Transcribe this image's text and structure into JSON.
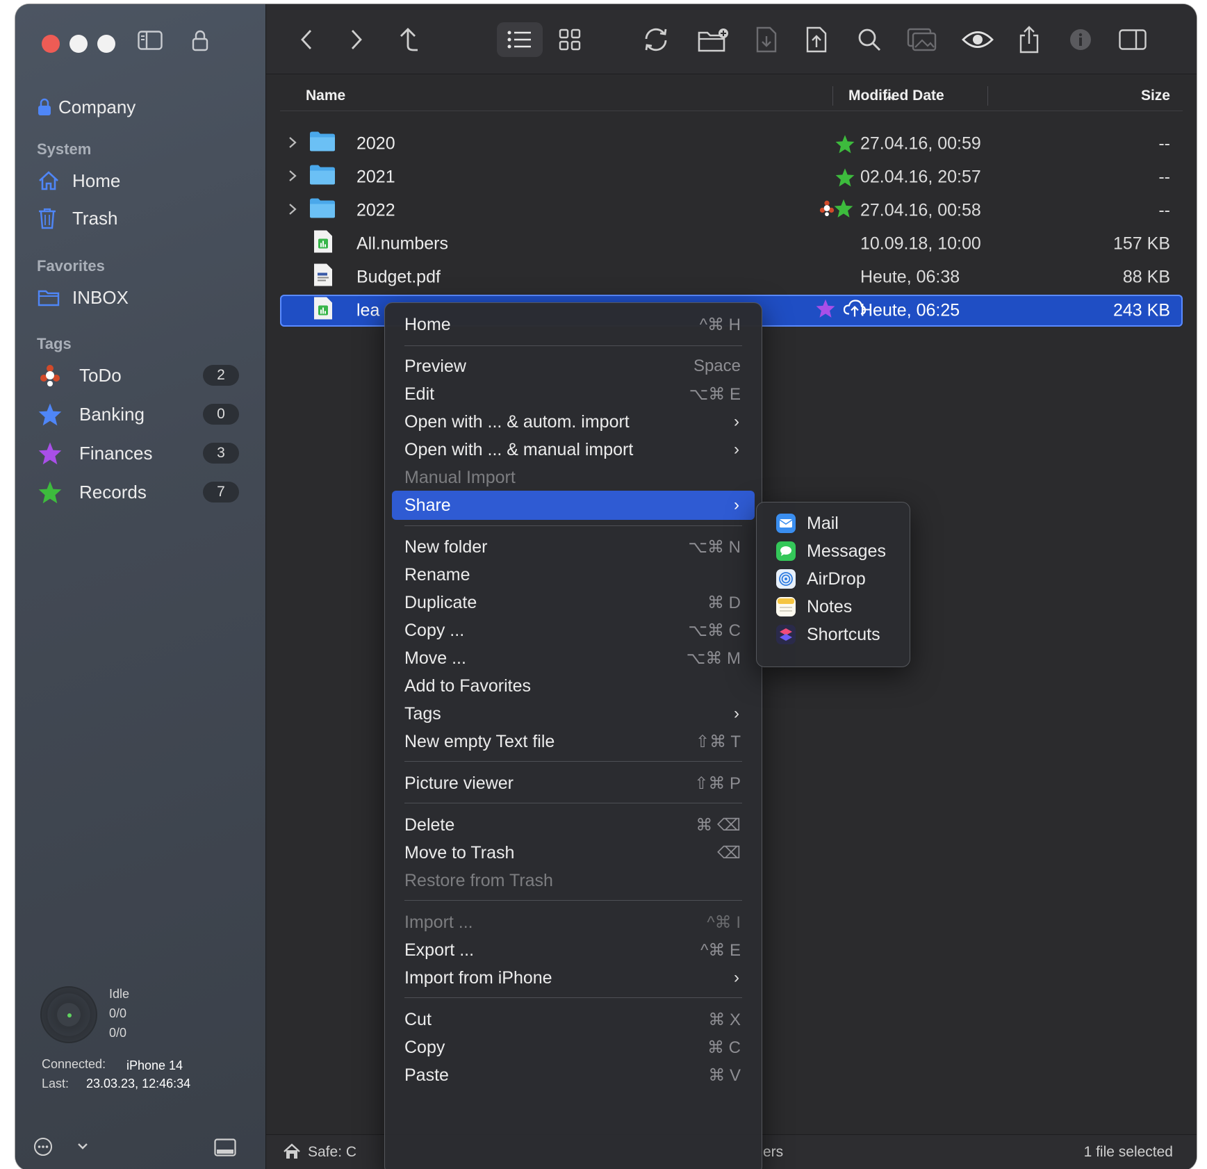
{
  "sidebar": {
    "vault": "Company",
    "system_label": "System",
    "home": "Home",
    "trash": "Trash",
    "favorites_label": "Favorites",
    "inbox": "INBOX",
    "tags_label": "Tags",
    "tags": [
      {
        "name": "ToDo",
        "count": "2"
      },
      {
        "name": "Banking",
        "count": "0"
      },
      {
        "name": "Finances",
        "count": "3"
      },
      {
        "name": "Records",
        "count": "7"
      }
    ],
    "status": {
      "state": "Idle",
      "line1": "0/0",
      "line2": "0/0"
    },
    "connected_label": "Connected:",
    "connected_value": "iPhone 14",
    "last_label": "Last:",
    "last_value": "23.03.23, 12:46:34"
  },
  "columns": {
    "name": "Name",
    "modified": "Modified Date",
    "size": "Size"
  },
  "rows": [
    {
      "name": "2020",
      "date": "27.04.16, 00:59",
      "size": "--"
    },
    {
      "name": "2021",
      "date": "02.04.16, 20:57",
      "size": "--"
    },
    {
      "name": "2022",
      "date": "27.04.16, 00:58",
      "size": "--"
    },
    {
      "name": "All.numbers",
      "date": "10.09.18, 10:00",
      "size": "157 KB"
    },
    {
      "name": "Budget.pdf",
      "date": "Heute, 06:38",
      "size": "88 KB"
    },
    {
      "name": "lea",
      "date": "Heute, 06:25",
      "size": "243 KB"
    }
  ],
  "menu": {
    "home": {
      "label": "Home",
      "shortcut": "^⌘ H"
    },
    "preview": {
      "label": "Preview",
      "shortcut": "Space"
    },
    "edit": {
      "label": "Edit",
      "shortcut": "⌥⌘ E"
    },
    "open_auto": {
      "label": "Open with ... & autom. import"
    },
    "open_manual": {
      "label": "Open with ... & manual import"
    },
    "manual_import": {
      "label": "Manual Import"
    },
    "share": {
      "label": "Share"
    },
    "new_folder": {
      "label": "New folder",
      "shortcut": "⌥⌘ N"
    },
    "rename": {
      "label": "Rename"
    },
    "duplicate": {
      "label": "Duplicate",
      "shortcut": "⌘ D"
    },
    "copy_dots": {
      "label": "Copy ...",
      "shortcut": "⌥⌘ C"
    },
    "move_dots": {
      "label": "Move ...",
      "shortcut": "⌥⌘ M"
    },
    "add_fav": {
      "label": "Add to Favorites"
    },
    "tags": {
      "label": "Tags"
    },
    "new_text": {
      "label": "New empty Text file",
      "shortcut": "⇧⌘ T"
    },
    "picture_viewer": {
      "label": "Picture viewer",
      "shortcut": "⇧⌘ P"
    },
    "delete": {
      "label": "Delete",
      "shortcut": "⌘ ⌫"
    },
    "move_trash": {
      "label": "Move to Trash",
      "shortcut": "⌫"
    },
    "restore": {
      "label": "Restore from Trash"
    },
    "import": {
      "label": "Import ...",
      "shortcut": "^⌘ I"
    },
    "export": {
      "label": "Export ...",
      "shortcut": "^⌘ E"
    },
    "import_iphone": {
      "label": "Import from iPhone"
    },
    "cut": {
      "label": "Cut",
      "shortcut": "⌘ X"
    },
    "copy": {
      "label": "Copy",
      "shortcut": "⌘ C"
    },
    "paste": {
      "label": "Paste",
      "shortcut": "⌘ V"
    }
  },
  "share_menu": [
    "Mail",
    "Messages",
    "AirDrop",
    "Notes",
    "Shortcuts"
  ],
  "statusbar": {
    "left": "Safe: C",
    "mid": "ers",
    "right": "1 file selected"
  },
  "colors": {
    "accent": "#2f5bd3",
    "green_star": "#3dbb3d",
    "blue_star": "#4f86f7",
    "purple_star": "#a94fe8"
  }
}
